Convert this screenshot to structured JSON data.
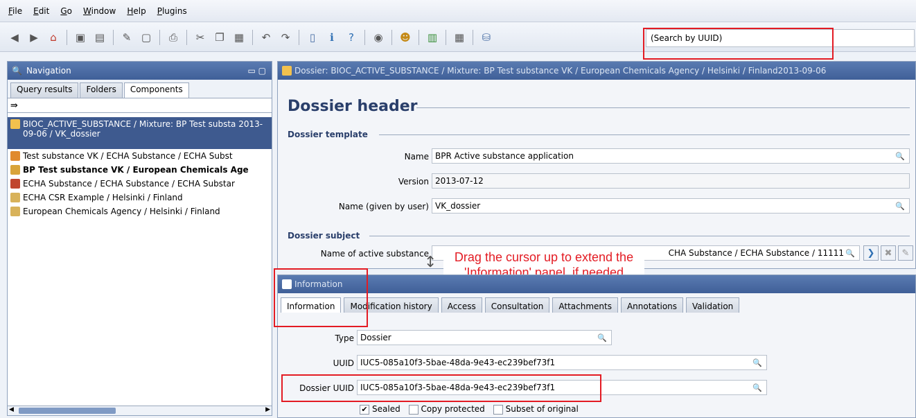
{
  "menu": [
    "File",
    "Edit",
    "Go",
    "Window",
    "Help",
    "Plugins"
  ],
  "search": {
    "placeholder": "(Search by UUID)"
  },
  "nav": {
    "title": "Navigation",
    "tabs": [
      "Query results",
      "Folders",
      "Components"
    ],
    "items": [
      {
        "label": "BIOC_ACTIVE_SUBSTANCE / Mixture: BP Test substa 2013-09-06 / VK_dossier"
      },
      {
        "label": "Test substance VK / ECHA Substance / ECHA Subst"
      },
      {
        "label": "BP Test substance VK / European Chemicals Age"
      },
      {
        "label": "ECHA Substance / ECHA Substance / ECHA Substar"
      },
      {
        "label": "ECHA CSR Example / Helsinki / Finland"
      },
      {
        "label": "European Chemicals Agency / Helsinki / Finland"
      }
    ]
  },
  "dossier": {
    "title": "Dossier: BIOC_ACTIVE_SUBSTANCE / Mixture: BP Test substance VK / European Chemicals Agency / Helsinki / Finland2013-09-06",
    "header": "Dossier header",
    "template_label": "Dossier template",
    "fields": {
      "name_label": "Name",
      "name_value": "BPR Active substance application",
      "version_label": "Version",
      "version_value": "2013-07-12",
      "given_label": "Name (given by user)",
      "given_value": "VK_dossier"
    },
    "subject_label": "Dossier subject",
    "active_label": "Name of active substance",
    "active_value": "CHA Substance / ECHA Substance / 11111"
  },
  "callout": "Drag the cursor up to extend the 'Information' panel, if needed",
  "info": {
    "title": "Information",
    "tabs": [
      "Information",
      "Modification history",
      "Access",
      "Consultation",
      "Attachments",
      "Annotations",
      "Validation"
    ],
    "type_label": "Type",
    "type_value": "Dossier",
    "uuid_label": "UUID",
    "uuid_value": "IUC5-085a10f3-5bae-48da-9e43-ec239bef73f1",
    "duuid_label": "Dossier UUID",
    "duuid_value": "IUC5-085a10f3-5bae-48da-9e43-ec239bef73f1",
    "checks": [
      {
        "label": "Sealed",
        "checked": true
      },
      {
        "label": "Copy protected",
        "checked": false
      },
      {
        "label": "Subset of original",
        "checked": false
      }
    ]
  }
}
